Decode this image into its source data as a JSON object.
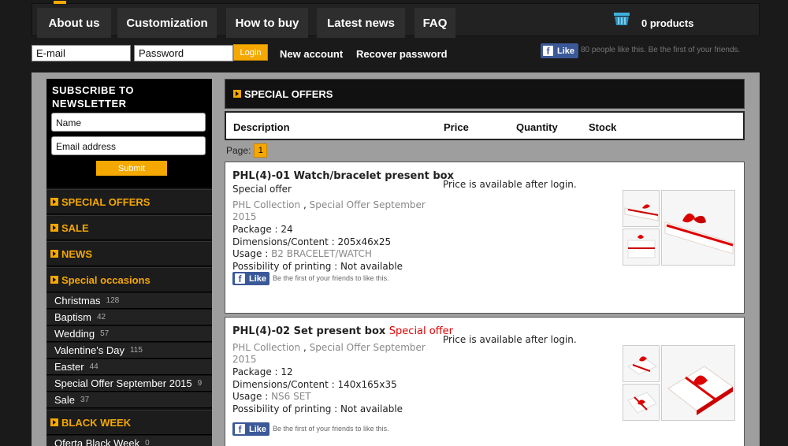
{
  "nav": {
    "items": [
      {
        "label": "About us"
      },
      {
        "label": "Customization"
      },
      {
        "label": "How to buy"
      },
      {
        "label": "Latest news"
      },
      {
        "label": "FAQ"
      }
    ],
    "cart_text": "0 products",
    "cart_icon": "basket-icon"
  },
  "login": {
    "email_value": "E-mail",
    "password_value": "Password",
    "login_label": "Login",
    "new_account": "New account",
    "recover_password": "Recover password",
    "fb_like": "Like",
    "fb_text": "80 people like this. Be the first of your friends."
  },
  "newsletter": {
    "title_line1": "SUBSCRIBE TO",
    "title_line2": "NEWSLETTER",
    "name_value": "Name",
    "email_value": "Email address",
    "submit_label": "Submit"
  },
  "sidebar": {
    "special_offers": "SPECIAL OFFERS",
    "sale": "SALE",
    "news": "NEWS",
    "special_occasions": "Special occasions",
    "occasions": [
      {
        "label": "Christmas",
        "count": "128"
      },
      {
        "label": "Baptism",
        "count": "42"
      },
      {
        "label": "Wedding",
        "count": "57"
      },
      {
        "label": "Valentine's Day",
        "count": "115"
      },
      {
        "label": "Easter",
        "count": "44"
      },
      {
        "label": "Special Offer September 2015",
        "count": "9"
      },
      {
        "label": "Sale",
        "count": "37"
      }
    ],
    "black_week": "BLACK WEEK",
    "black_week_items": [
      {
        "label": "Oferta Black Week",
        "count": "0"
      }
    ]
  },
  "content": {
    "header": "SPECIAL OFFERS",
    "columns": [
      "Description",
      "Price",
      "Quantity",
      "Stock"
    ],
    "page_label": "Page:",
    "page_number": "1",
    "products": [
      {
        "title": "PHL(4)-01 Watch/bracelet present box",
        "special": "Special offer",
        "collection": "PHL Collection",
        "sep": ",",
        "offer_line1": "Special Offer September",
        "offer_line2": "2015",
        "package": "Package : 24",
        "dimensions": "Dimensions/Content : 205x46x25",
        "usage_label": "Usage : ",
        "usage_value": "B2 BRACELET/WATCH",
        "printing": "Possibility of printing : Not available",
        "price": "Price is available after login.",
        "fb_like": "Like",
        "fb_text": "Be the first of your friends to like this."
      },
      {
        "title": "PHL(4)-02 Set present box",
        "special": "Special offer",
        "collection": "PHL Collection",
        "sep": ",",
        "offer_line1": "Special Offer September",
        "offer_line2": "2015",
        "package": "Package : 12",
        "dimensions": "Dimensions/Content : 140x165x35",
        "usage_label": "Usage : ",
        "usage_value": "NS6 SET",
        "printing": "Possibility of printing : Not available",
        "price": "Price is available after login.",
        "fb_like": "Like",
        "fb_text": "Be the first of your friends to like this."
      }
    ]
  },
  "colors": {
    "accent": "#f5a800",
    "special": "#dd0000",
    "facebook": "#3b5998"
  }
}
